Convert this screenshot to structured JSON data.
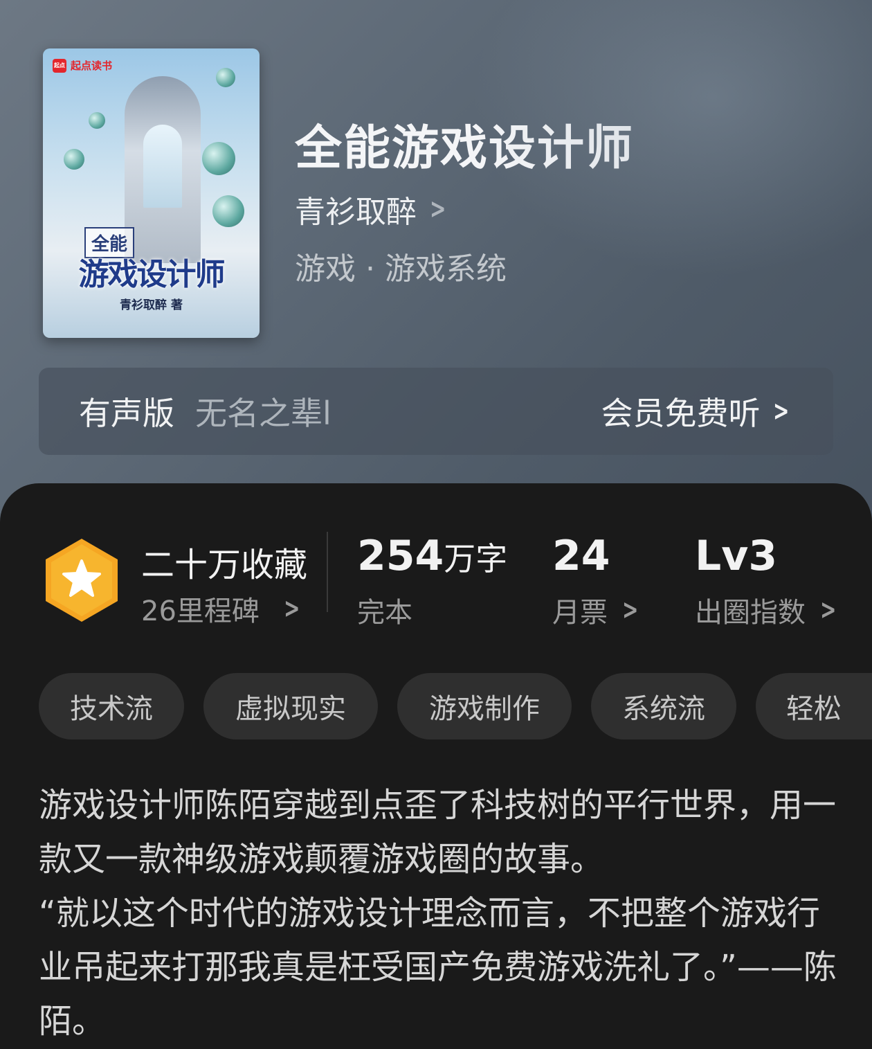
{
  "book": {
    "title": "全能游戏设计师",
    "author": "青衫取醉",
    "genre": "游戏 · 游戏系统",
    "cover": {
      "brand": "起点读书",
      "brand_icon_text": "起点",
      "small_title": "全能",
      "big_title": "游戏设计师",
      "author_line": "青衫取醉 著"
    }
  },
  "audio": {
    "label": "有声版",
    "narrator": "无名之辈l",
    "cta": "会员免费听"
  },
  "stats": {
    "favorites": "二十万收藏",
    "milestones": "26里程碑",
    "words_value": "254",
    "words_unit": "万字",
    "status": "完本",
    "monthly_votes_value": "24",
    "monthly_votes_label": "月票",
    "level_value": "Lv3",
    "level_label": "出圈指数"
  },
  "tags": [
    "技术流",
    "虚拟现实",
    "游戏制作",
    "系统流",
    "轻松"
  ],
  "description": [
    "游戏设计师陈陌穿越到点歪了科技树的平行世界，用一款又一款神级游戏颠覆游戏圈的故事。",
    "“就以这个时代的游戏设计理念而言，不把整个游戏行业吊起来打那我真是枉受国产免费游戏洗礼了。”——陈陌。"
  ],
  "colors": {
    "medal_gold": "#f5a623",
    "sheet_bg": "#1a1a1a",
    "tag_bg": "#2f2f2f"
  }
}
